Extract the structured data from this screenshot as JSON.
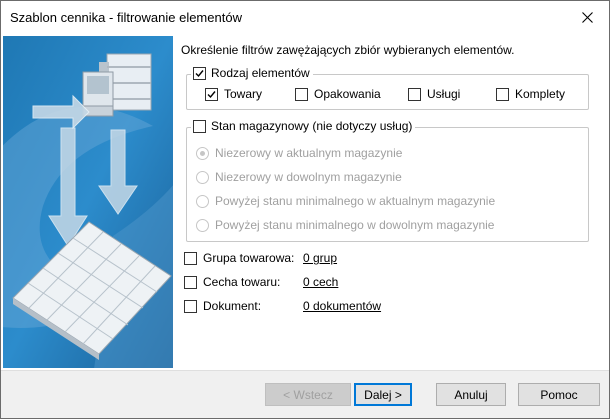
{
  "window": {
    "title": "Szablon cennika - filtrowanie elementów"
  },
  "header": {
    "text": "Określenie filtrów zawężających zbiór wybieranych elementów."
  },
  "group_type": {
    "label": "Rodzaj elementów",
    "checked": true,
    "options": [
      {
        "label": "Towary",
        "checked": true
      },
      {
        "label": "Opakowania",
        "checked": false
      },
      {
        "label": "Usługi",
        "checked": false
      },
      {
        "label": "Komplety",
        "checked": false
      }
    ]
  },
  "group_stock": {
    "label": "Stan magazynowy (nie dotyczy usług)",
    "checked": false,
    "options": [
      {
        "label": "Niezerowy w aktualnym magazynie",
        "selected": true
      },
      {
        "label": "Niezerowy w dowolnym magazynie",
        "selected": false
      },
      {
        "label": "Powyżej stanu minimalnego w aktualnym magazynie",
        "selected": false
      },
      {
        "label": "Powyżej stanu minimalnego w dowolnym magazynie",
        "selected": false
      }
    ]
  },
  "filters": [
    {
      "label": "Grupa towarowa:",
      "link": "0 grup",
      "checked": false
    },
    {
      "label": "Cecha towaru:",
      "link": "0 cech",
      "checked": false
    },
    {
      "label": "Dokument:",
      "link": "0 dokumentów",
      "checked": false
    }
  ],
  "buttons": {
    "back": "< Wstecz",
    "next": "Dalej >",
    "cancel": "Anuluj",
    "help": "Pomoc"
  },
  "colors": {
    "accent": "#0078d7",
    "side_dark": "#1e6fa6",
    "side_light": "#cfe3f0"
  }
}
